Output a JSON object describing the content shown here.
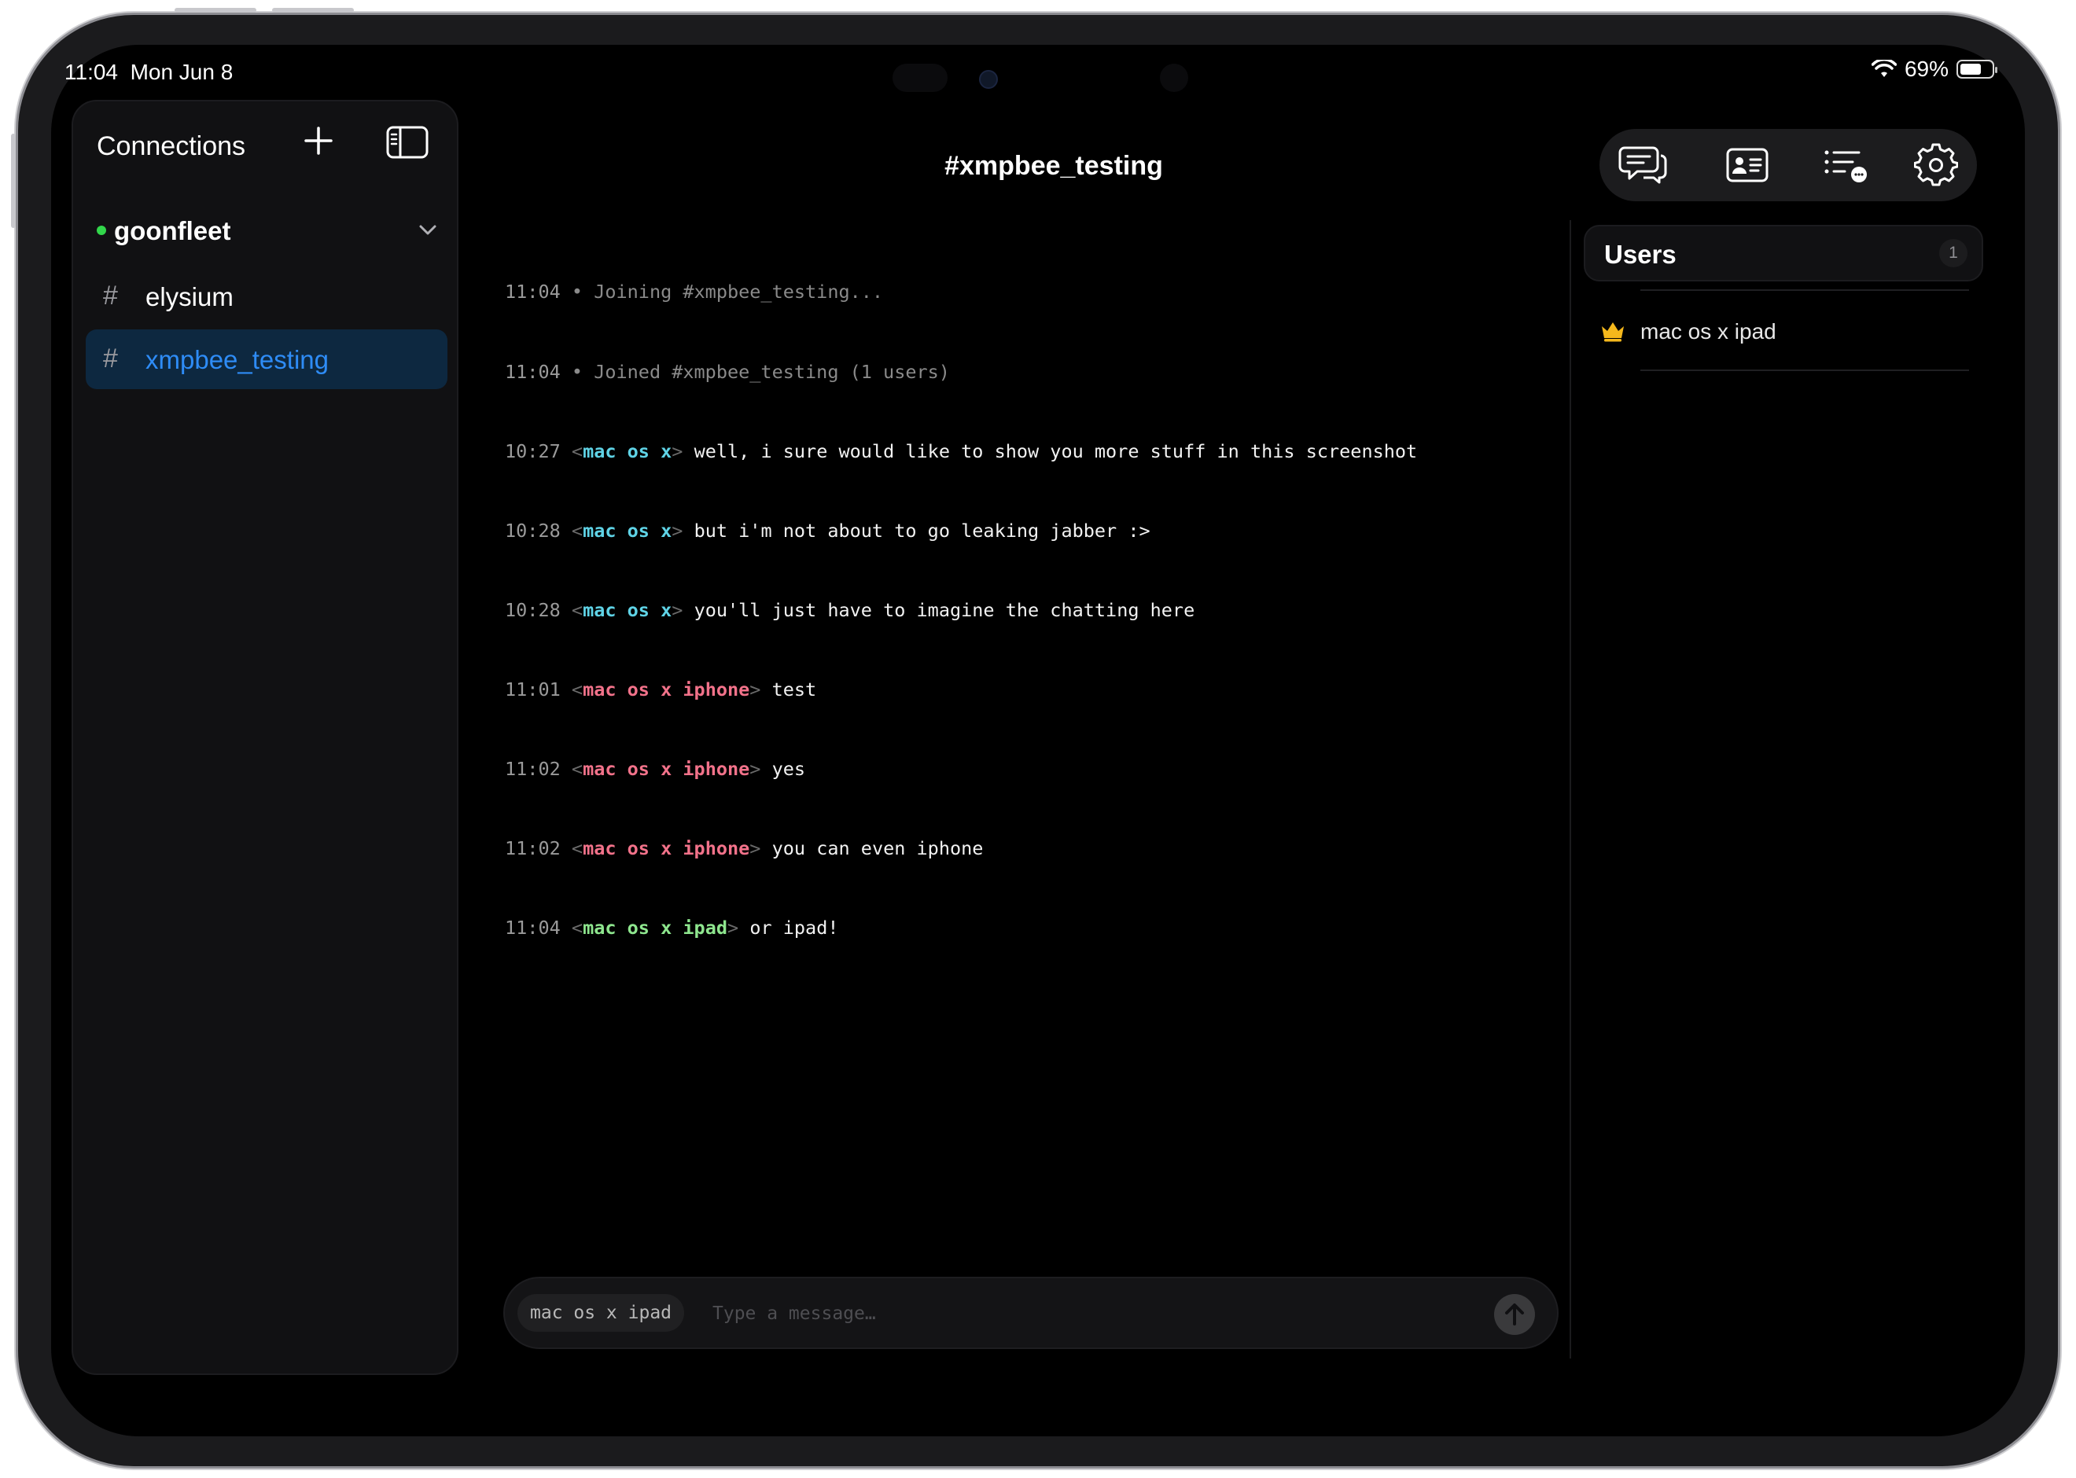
{
  "status_bar": {
    "time": "11:04",
    "date": "Mon Jun 8",
    "battery_percent": "69%",
    "battery_level": 0.69
  },
  "sidebar": {
    "title": "Connections",
    "server": {
      "name": "goonfleet",
      "status": "online"
    },
    "channels": [
      {
        "hash": "#",
        "name": "elysium",
        "active": false
      },
      {
        "hash": "#",
        "name": "xmpbee_testing",
        "active": true
      }
    ]
  },
  "header": {
    "title": "#xmpbee_testing",
    "toolbar": [
      "chat-bubbles-icon",
      "contact-card-icon",
      "list-chat-icon",
      "gear-icon"
    ]
  },
  "log": [
    {
      "time": "11:04",
      "kind": "system",
      "text": "• Joining #xmpbee_testing..."
    },
    {
      "time": "11:04",
      "kind": "system",
      "text": "• Joined #xmpbee_testing (1 users)"
    },
    {
      "time": "10:27",
      "kind": "message",
      "nick": "mac os x",
      "nick_color": "cyan",
      "text": "well, i sure would like to show you more stuff in this screenshot"
    },
    {
      "time": "10:28",
      "kind": "message",
      "nick": "mac os x",
      "nick_color": "cyan",
      "text": "but i'm not about to go leaking jabber :>"
    },
    {
      "time": "10:28",
      "kind": "message",
      "nick": "mac os x",
      "nick_color": "cyan",
      "text": "you'll just have to imagine the chatting here"
    },
    {
      "time": "11:01",
      "kind": "message",
      "nick": "mac os x iphone",
      "nick_color": "pink",
      "text": "test"
    },
    {
      "time": "11:02",
      "kind": "message",
      "nick": "mac os x iphone",
      "nick_color": "pink",
      "text": "yes"
    },
    {
      "time": "11:02",
      "kind": "message",
      "nick": "mac os x iphone",
      "nick_color": "pink",
      "text": "you can even iphone"
    },
    {
      "time": "11:04",
      "kind": "message",
      "nick": "mac os x ipad",
      "nick_color": "green",
      "text": "or ipad!"
    }
  ],
  "composer": {
    "nick": "mac os x ipad",
    "placeholder": "Type a message…",
    "value": ""
  },
  "users": {
    "title": "Users",
    "count": "1",
    "list": [
      {
        "name": "mac os x ipad",
        "role": "owner"
      }
    ]
  },
  "colors": {
    "accent": "#2e8cf6",
    "online": "#32d74b",
    "nick_cyan": "#5fd3e6",
    "nick_pink": "#f2728a",
    "nick_green": "#8ee68e",
    "crown": "#f5b81c"
  }
}
